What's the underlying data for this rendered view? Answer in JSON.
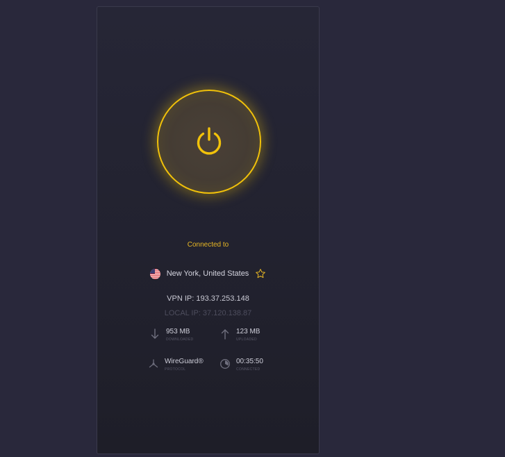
{
  "status": {
    "label": "Connected to"
  },
  "location": {
    "name": "New York, United States",
    "flag_icon": "us-flag-icon",
    "favorite_icon": "star-icon"
  },
  "ip": {
    "vpn": "VPN IP: 193.37.253.148",
    "local": "LOCAL IP: 37.120.138.87"
  },
  "stats": {
    "downloaded": {
      "value": "953 MB",
      "label": "DOWNLOADED",
      "icon": "arrow-down-icon"
    },
    "uploaded": {
      "value": "123 MB",
      "label": "UPLOADED",
      "icon": "arrow-up-icon"
    },
    "protocol": {
      "value": "WireGuard®",
      "label": "PROTOCOL",
      "icon": "protocol-icon"
    },
    "connected": {
      "value": "00:35:50",
      "label": "CONNECTED",
      "icon": "timer-icon"
    }
  },
  "colors": {
    "background": "#29283b",
    "panel": "#232331",
    "accent": "#f2c20a",
    "status_text": "#e9b824"
  }
}
